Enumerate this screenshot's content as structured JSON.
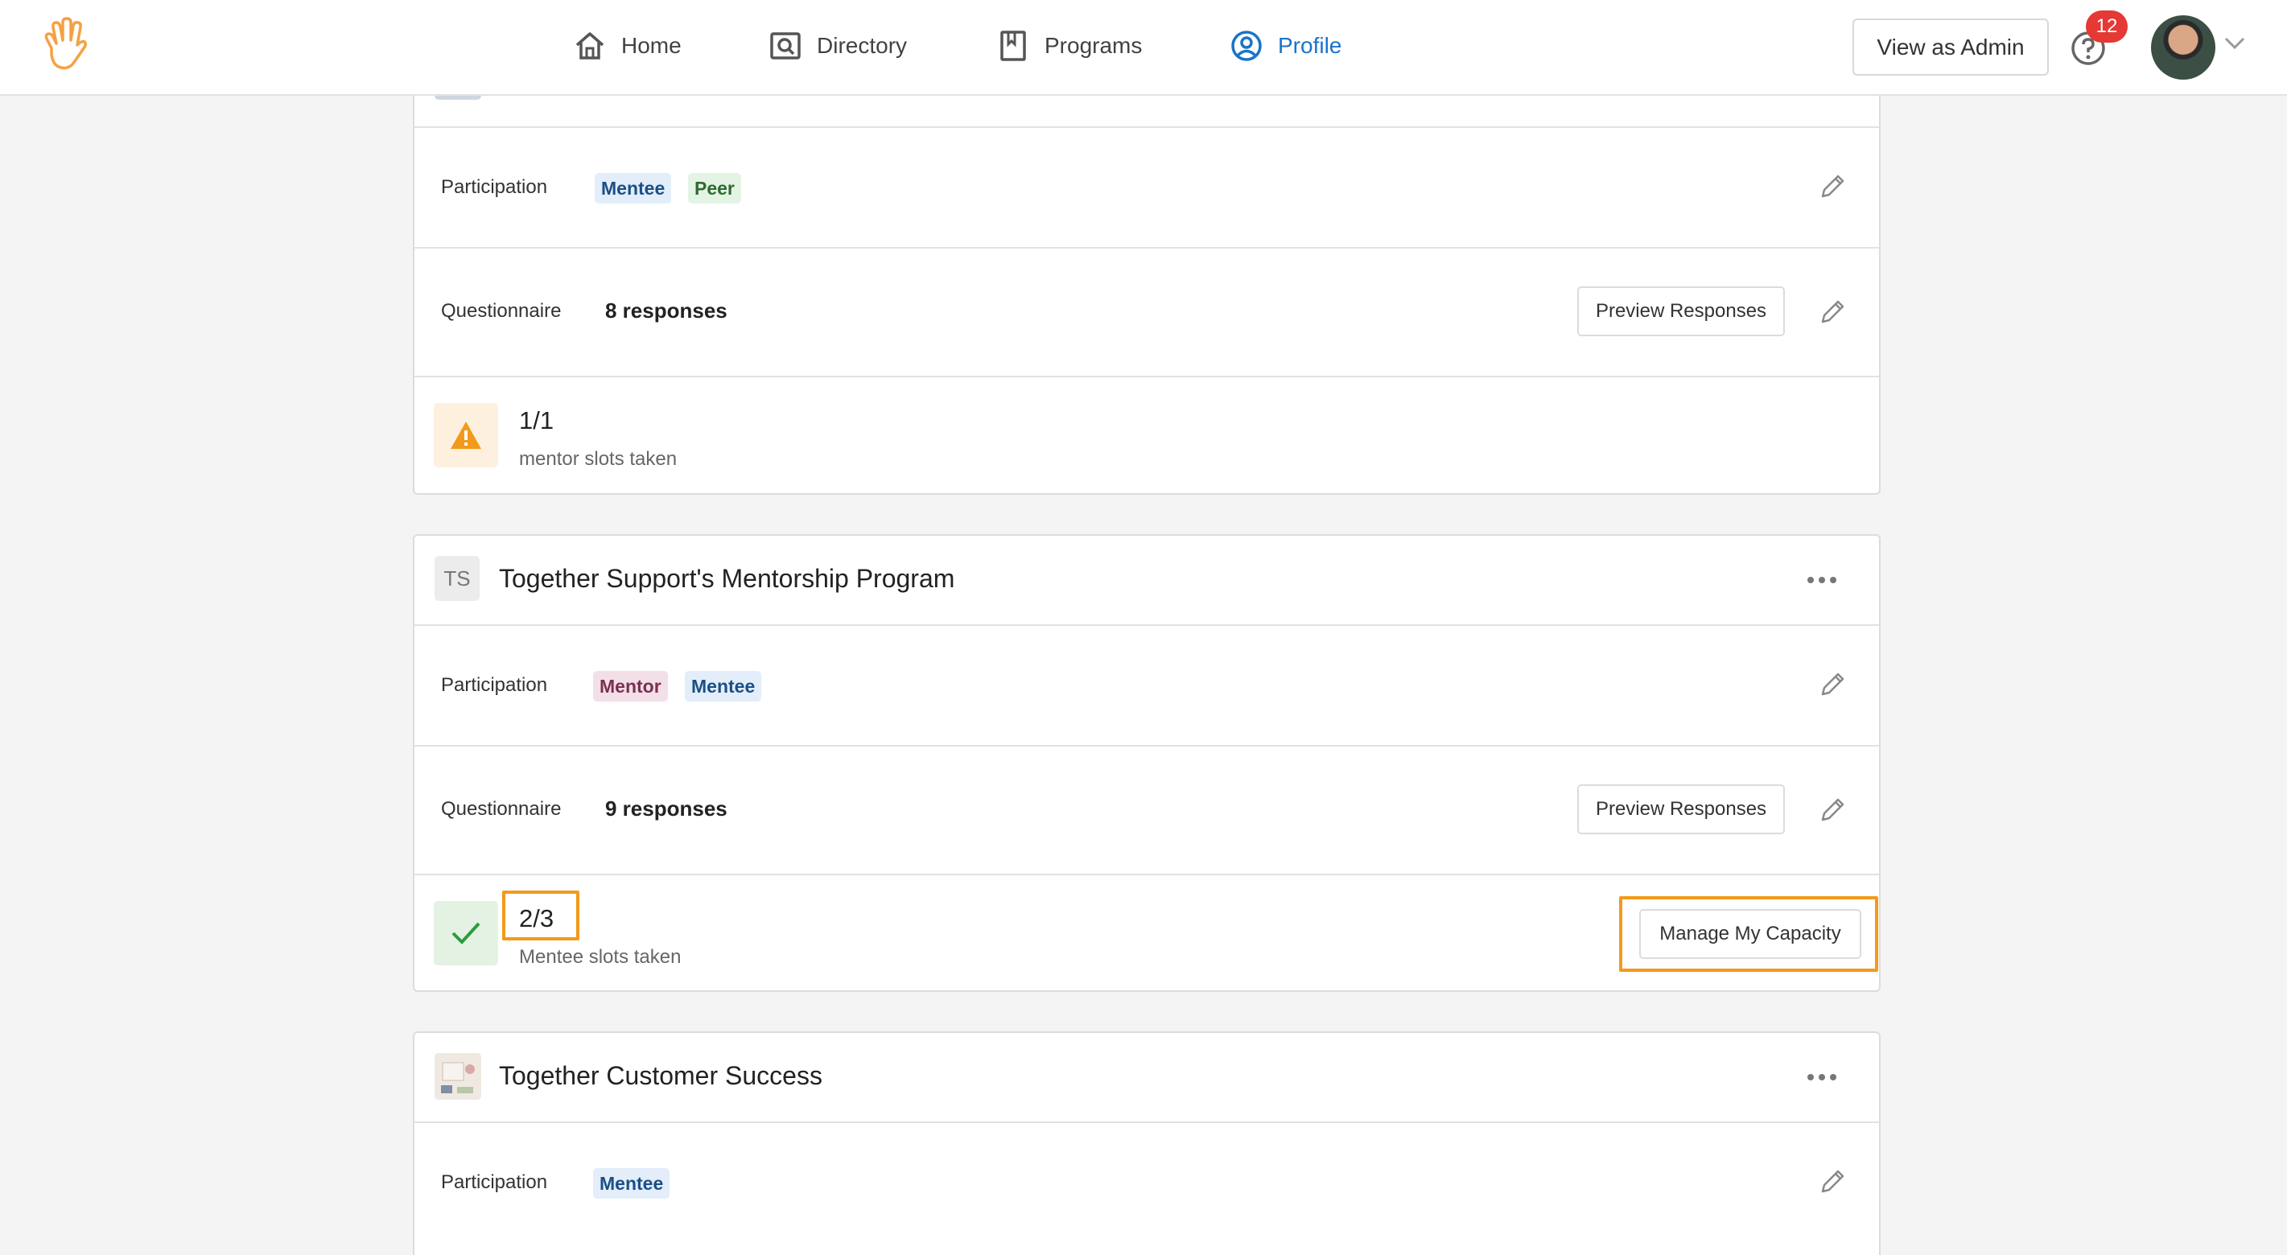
{
  "nav": {
    "items": [
      {
        "label": "Home",
        "icon": "home-icon"
      },
      {
        "label": "Directory",
        "icon": "directory-icon"
      },
      {
        "label": "Programs",
        "icon": "book-icon"
      },
      {
        "label": "Profile",
        "icon": "profile-icon"
      }
    ],
    "active": "Profile",
    "admin_button": "View as Admin",
    "notification_count": "12",
    "accent_color": "#1a73c9",
    "brand_color": "#f5a142"
  },
  "cards": [
    {
      "participation_label": "Participation",
      "tags": [
        "Mentee",
        "Peer"
      ],
      "questionnaire_label": "Questionnaire",
      "responses": "8 responses",
      "preview_label": "Preview Responses",
      "slots_count": "1/1",
      "slots_text": "mentor slots taken",
      "status": "warning"
    },
    {
      "badge": "TS",
      "title": "Together Support's Mentorship Program",
      "participation_label": "Participation",
      "tags": [
        "Mentor",
        "Mentee"
      ],
      "questionnaire_label": "Questionnaire",
      "responses": "9 responses",
      "preview_label": "Preview Responses",
      "slots_count": "2/3",
      "slots_text": "Mentee slots taken",
      "capacity_button": "Manage My Capacity",
      "status": "ok"
    },
    {
      "title": "Together Customer Success",
      "participation_label": "Participation",
      "tags": [
        "Mentee"
      ]
    }
  ],
  "colors": {
    "highlight": "#f29a1c",
    "warning": "#f29a1c",
    "success": "#2e9b3e"
  }
}
